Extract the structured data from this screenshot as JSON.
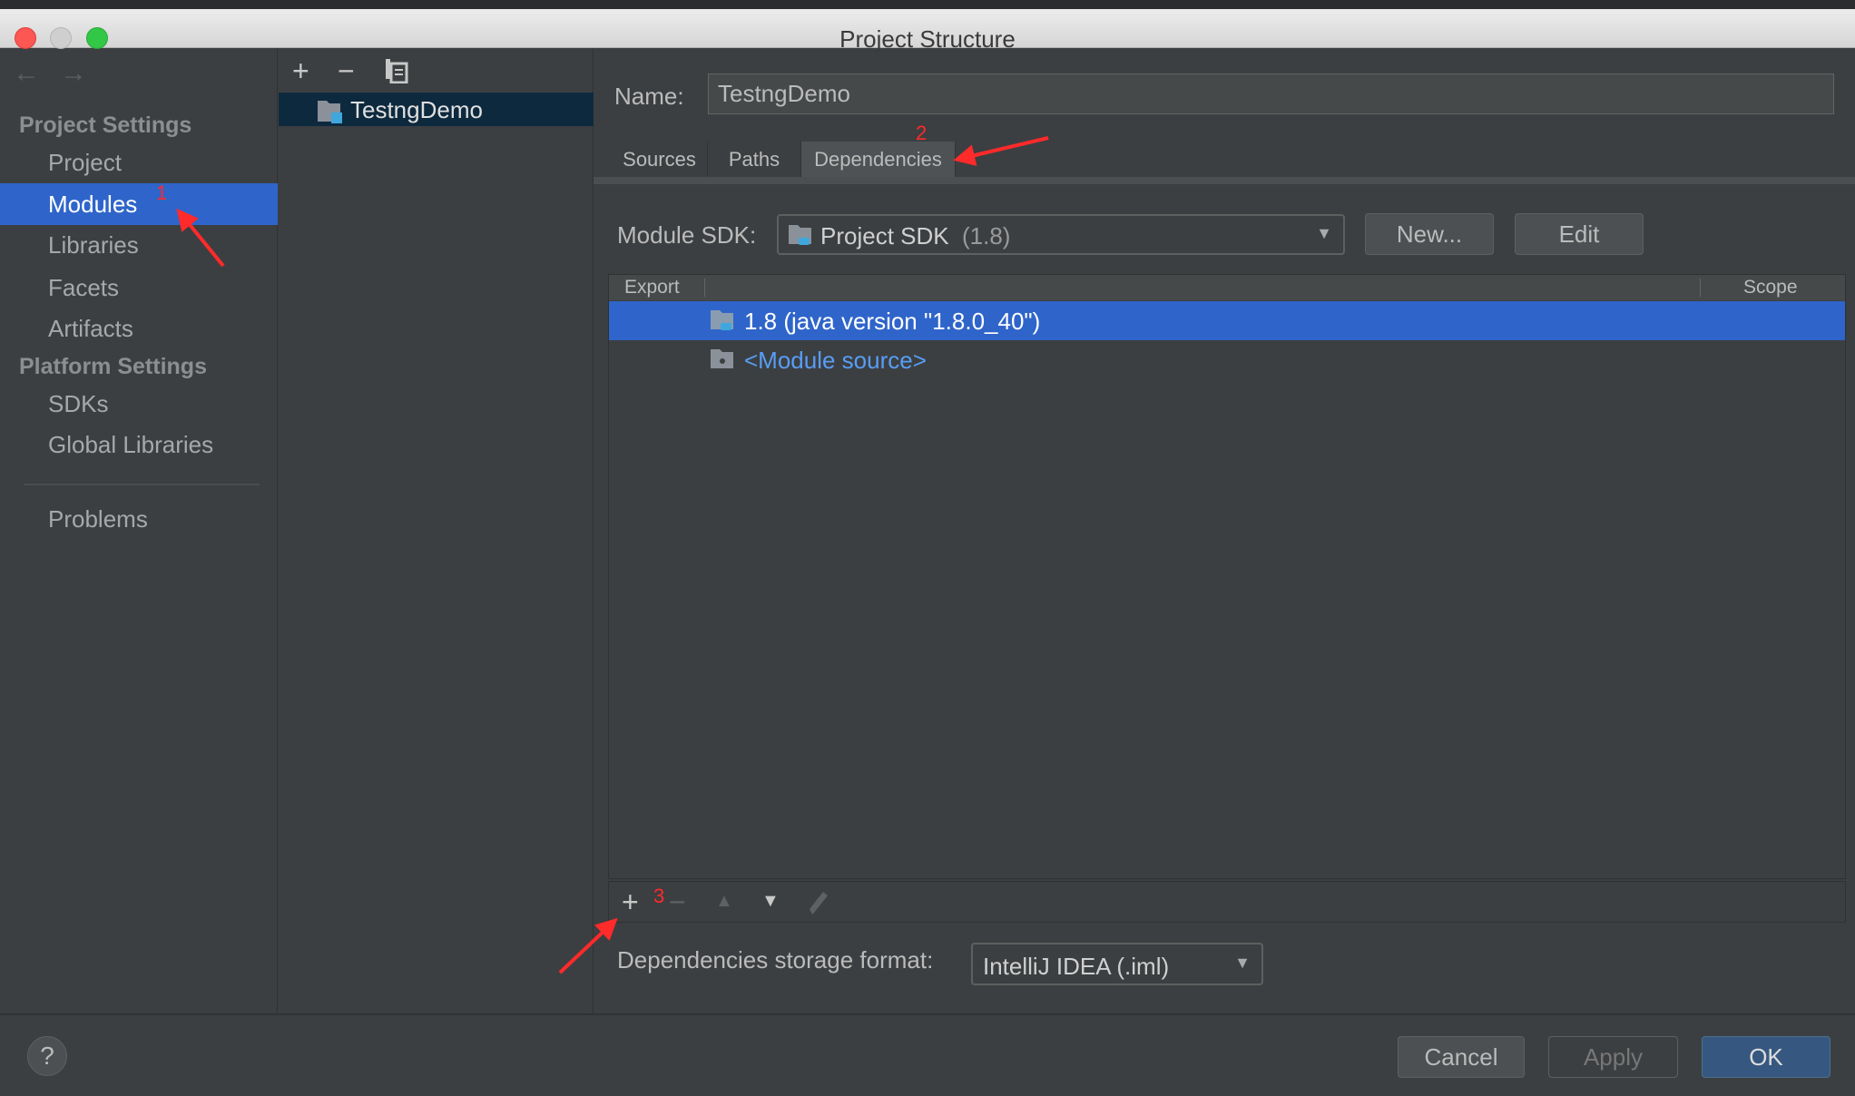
{
  "window": {
    "title": "Project Structure",
    "traffic_lights": {
      "close": "#fc5753",
      "minimize": "#cfcfcf",
      "maximize": "#33c748"
    }
  },
  "sidebar": {
    "back_icon": "←",
    "forward_icon": "→",
    "sections": [
      {
        "header": "Project Settings",
        "items": [
          {
            "label": "Project"
          },
          {
            "label": "Modules",
            "selected": true
          },
          {
            "label": "Libraries"
          },
          {
            "label": "Facets"
          },
          {
            "label": "Artifacts"
          }
        ]
      },
      {
        "header": "Platform Settings",
        "items": [
          {
            "label": "SDKs"
          },
          {
            "label": "Global Libraries"
          }
        ]
      }
    ],
    "problems": "Problems"
  },
  "middle": {
    "toolbar": {
      "add": "+",
      "remove": "−",
      "copy_icon": "copy-icon"
    },
    "tree": [
      {
        "label": "TestngDemo",
        "selected": true
      }
    ]
  },
  "main": {
    "name_label": "Name:",
    "name_value": "TestngDemo",
    "tabs": [
      {
        "label": "Sources"
      },
      {
        "label": "Paths"
      },
      {
        "label": "Dependencies",
        "selected": true
      }
    ],
    "sdk_label": "Module SDK:",
    "sdk_value": "Project SDK",
    "sdk_version": "(1.8)",
    "new_button": "New...",
    "edit_button": "Edit",
    "table": {
      "columns": [
        "Export",
        "",
        "Scope"
      ],
      "rows": [
        {
          "label": "1.8 (java version \"1.8.0_40\")",
          "selected": true
        },
        {
          "label": "<Module source>",
          "link": true
        }
      ]
    },
    "table_toolbar": {
      "add": "+",
      "remove": "−",
      "up": "▲",
      "down": "▼",
      "edit_icon": "pencil-icon"
    },
    "storage_label": "Dependencies storage format:",
    "storage_value": "IntelliJ IDEA (.iml)"
  },
  "footer": {
    "help": "?",
    "cancel": "Cancel",
    "apply": "Apply",
    "ok": "OK"
  },
  "annotations": {
    "step1": "1",
    "step2": "2",
    "step3": "3",
    "color": "#ff2a2a"
  },
  "colors": {
    "selection": "#2f65ca",
    "tree_selection": "#0d293e",
    "link": "#589df6",
    "ok_button": "#365880"
  }
}
